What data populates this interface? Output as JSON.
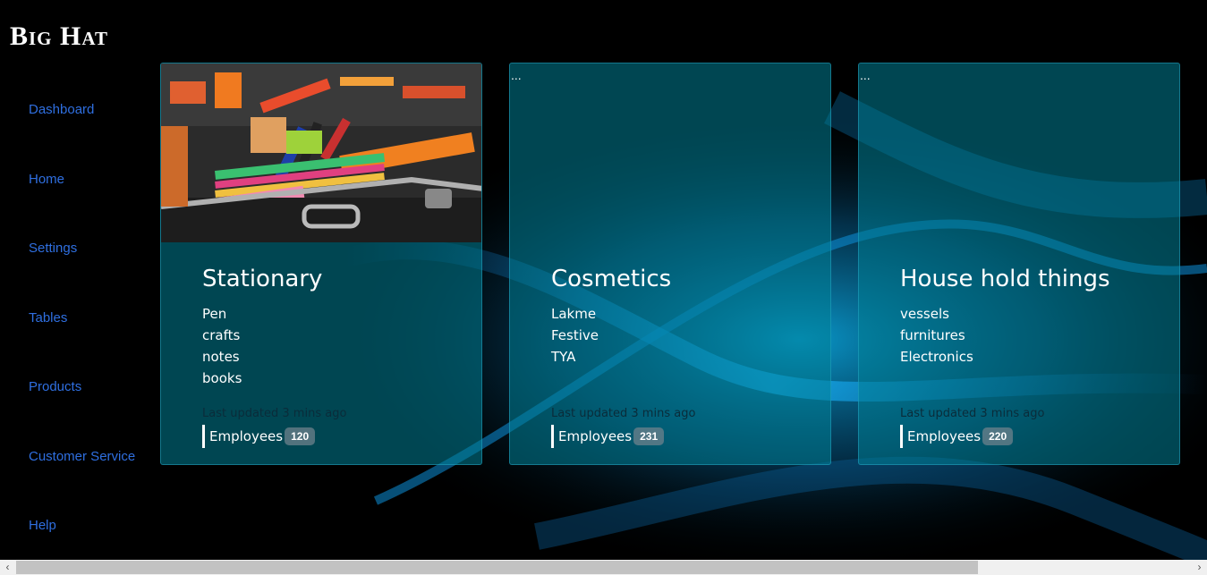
{
  "brand": "Big Hat",
  "sidebar": {
    "items": [
      {
        "label": "Dashboard"
      },
      {
        "label": "Home"
      },
      {
        "label": "Settings"
      },
      {
        "label": "Tables"
      },
      {
        "label": "Products"
      },
      {
        "label": "Customer Service"
      },
      {
        "label": "Help"
      }
    ]
  },
  "cards": [
    {
      "title": "Stationary",
      "items": [
        "Pen",
        "crafts",
        "notes",
        "books"
      ],
      "updated": "Last updated 3 mins ago",
      "employees_label": "Employees",
      "employees_count": "120"
    },
    {
      "image_alt": "...",
      "title": "Cosmetics",
      "items": [
        "Lakme",
        "Festive",
        "TYA"
      ],
      "updated": "Last updated 3 mins ago",
      "employees_label": "Employees",
      "employees_count": "231"
    },
    {
      "image_alt": "...",
      "title": "House hold things",
      "items": [
        "vessels",
        "furnitures",
        "Electronics"
      ],
      "updated": "Last updated 3 mins ago",
      "employees_label": "Employees",
      "employees_count": "220"
    }
  ],
  "colors": {
    "nav_link": "#2f6fe0",
    "card_bg": "#00808f",
    "page_bg": "#000000"
  }
}
